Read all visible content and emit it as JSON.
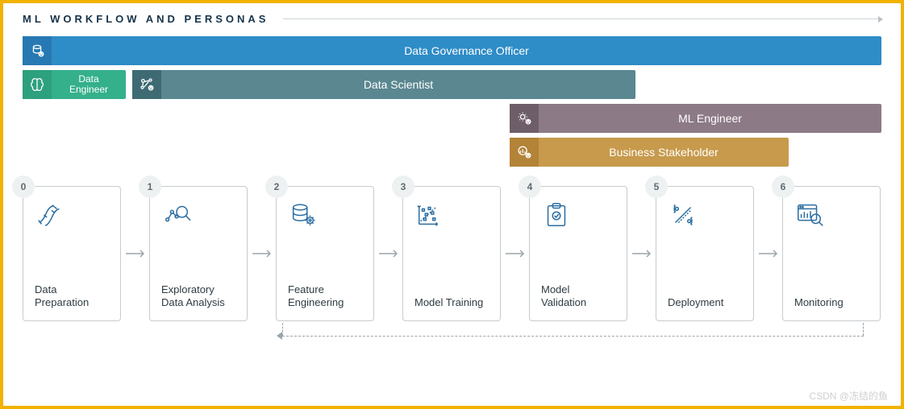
{
  "title": "ML WORKFLOW AND PERSONAS",
  "personas": {
    "gov": {
      "label": "Data Governance Officer",
      "color": "#2e8cc7",
      "chipColor": "#2679b2",
      "icon": "shield-db"
    },
    "de": {
      "label": "Data Engineer",
      "color": "#34b08a",
      "chipColor": "#2da07d",
      "icon": "brain"
    },
    "ds": {
      "label": "Data Scientist",
      "color": "#5a8790",
      "chipColor": "#3e6a73",
      "icon": "network-user"
    },
    "mle": {
      "label": "ML Engineer",
      "color": "#8d7a87",
      "chipColor": "#6e5e69",
      "icon": "gear-user"
    },
    "biz": {
      "label": "Business Stakeholder",
      "color": "#c79a4c",
      "chipColor": "#b38337",
      "icon": "chart-user"
    }
  },
  "steps": [
    {
      "n": "0",
      "label": "Data Preparation",
      "icon": "pipe"
    },
    {
      "n": "1",
      "label": "Exploratory Data Analysis",
      "icon": "scatter-lens"
    },
    {
      "n": "2",
      "label": "Feature Engineering",
      "icon": "db-gear"
    },
    {
      "n": "3",
      "label": "Model Training",
      "icon": "train"
    },
    {
      "n": "4",
      "label": "Model Validation",
      "icon": "clipboard"
    },
    {
      "n": "5",
      "label": "Deployment",
      "icon": "deploy"
    },
    {
      "n": "6",
      "label": "Monitoring",
      "icon": "monitor-lens"
    }
  ],
  "watermark": "CSDN @冻结的鱼"
}
